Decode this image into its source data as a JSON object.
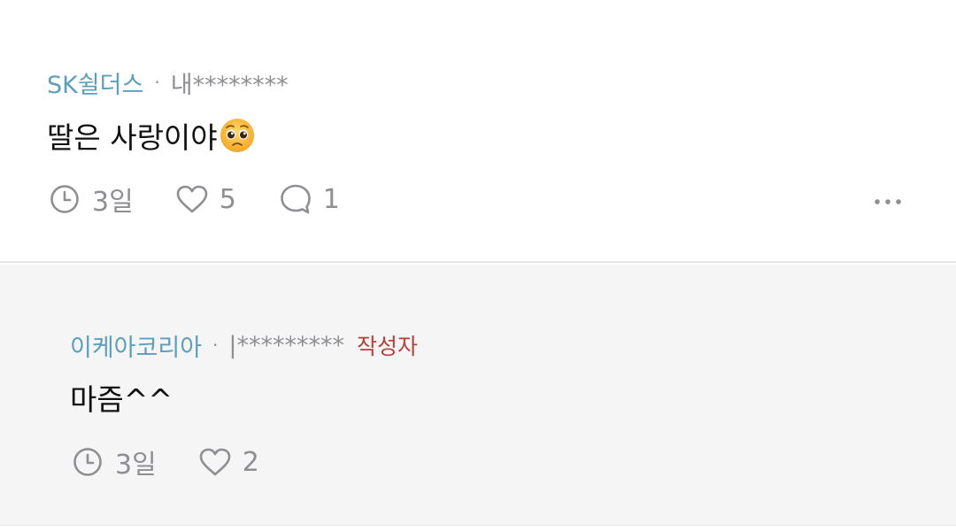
{
  "comments": [
    {
      "author": "SK쉴더스",
      "separator": "·",
      "masked_id": "내********",
      "text": "딸은 사랑이야",
      "emoji": "pleading-face-emoji",
      "time": "3일",
      "likes": "5",
      "replies": "1",
      "more_icon": "more-horizontal-icon"
    },
    {
      "author": "이케아코리아",
      "separator": "·",
      "masked_id": "|*********",
      "badge": "작성자",
      "text": "마즘^^",
      "time": "3일",
      "likes": "2"
    }
  ],
  "colors": {
    "author": "#5b9fbd",
    "meta": "#8e8e93",
    "badge": "#b5403a",
    "text": "#111111",
    "reply_bg": "#f5f5f5"
  },
  "icons": [
    "clock-icon",
    "heart-icon",
    "comment-bubble-icon",
    "more-horizontal-icon"
  ]
}
